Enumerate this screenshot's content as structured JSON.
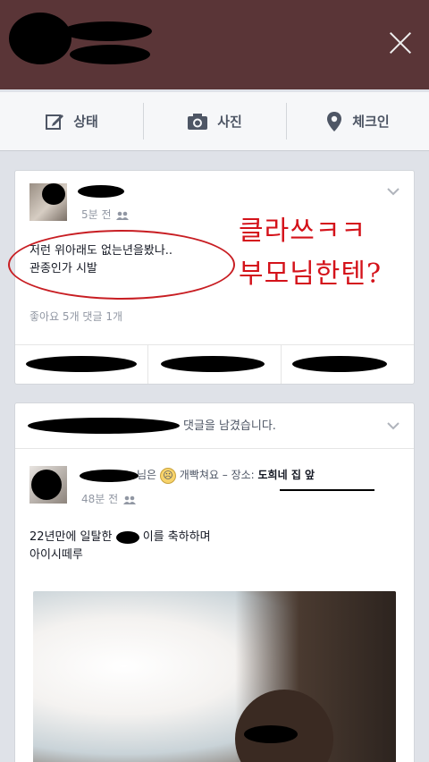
{
  "composer": {
    "status_label": "상태",
    "photo_label": "사진",
    "checkin_label": "체크인"
  },
  "post1": {
    "time": "5분 전",
    "text_line1": "저런 위아래도 없는년을봤나..",
    "text_line2": "관종인가 시발",
    "stats": "좋아요 5개  댓글 1개",
    "annotation_line1": "클라쓰ㅋㅋ",
    "annotation_line2": "부모님한텐?"
  },
  "post2": {
    "header": "님이 댓글을 남겼습니다.",
    "header_visible": "댓글을 남겼습니다.",
    "author_suffix": "님은",
    "feeling": "개빡쳐요",
    "location_label": "장소:",
    "location": "도희네 집 앞",
    "time": "48분 전",
    "text_line1": "22년만에 일탈한",
    "text_line1b": "이를 축하하며",
    "text_line2": "아이시떼루"
  },
  "colors": {
    "topbar": "#5a3537",
    "annotation_red": "#d4121a",
    "meta_gray": "#9197a3"
  }
}
